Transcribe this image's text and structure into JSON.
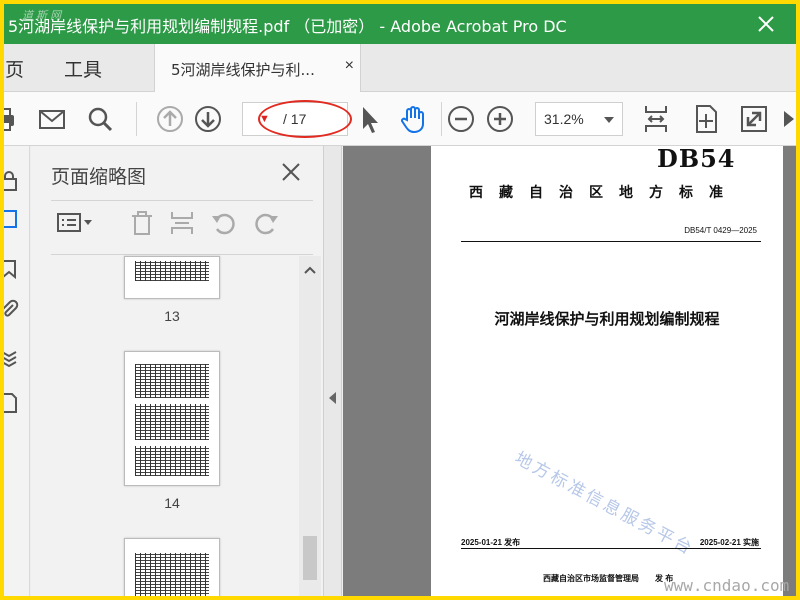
{
  "window": {
    "title": "5河湖岸线保护与利用规划编制规程.pdf （已加密） - Adobe Acrobat Pro DC",
    "watermark_top": "道 斯 网"
  },
  "tabs": {
    "home": "主页",
    "tools": "工具",
    "document": "5河湖岸线保护与利...",
    "close": "×"
  },
  "toolbar": {
    "page_total": "/ 17",
    "zoom": "31.2%"
  },
  "thumbnails": {
    "title": "页面缩略图",
    "pages": [
      {
        "label": "13"
      },
      {
        "label": "14"
      }
    ]
  },
  "document": {
    "code": "DB54",
    "authority": "西藏自治区地方标准",
    "standard_no": "DB54/T 0429—2025",
    "title": "河湖岸线保护与利用规划编制规程",
    "watermark": "地方标准信息服务平台",
    "issue_date": "2025-01-21 发布",
    "impl_date": "2025-02-21 实施",
    "publisher": "西藏自治区市场监督管理局　　发 布"
  },
  "site_watermark": "www.cndao.com",
  "colors": {
    "titlebar": "#2d9a47",
    "highlight": "#e12a20",
    "accent": "#1473e6",
    "frame": "#ffd900"
  }
}
